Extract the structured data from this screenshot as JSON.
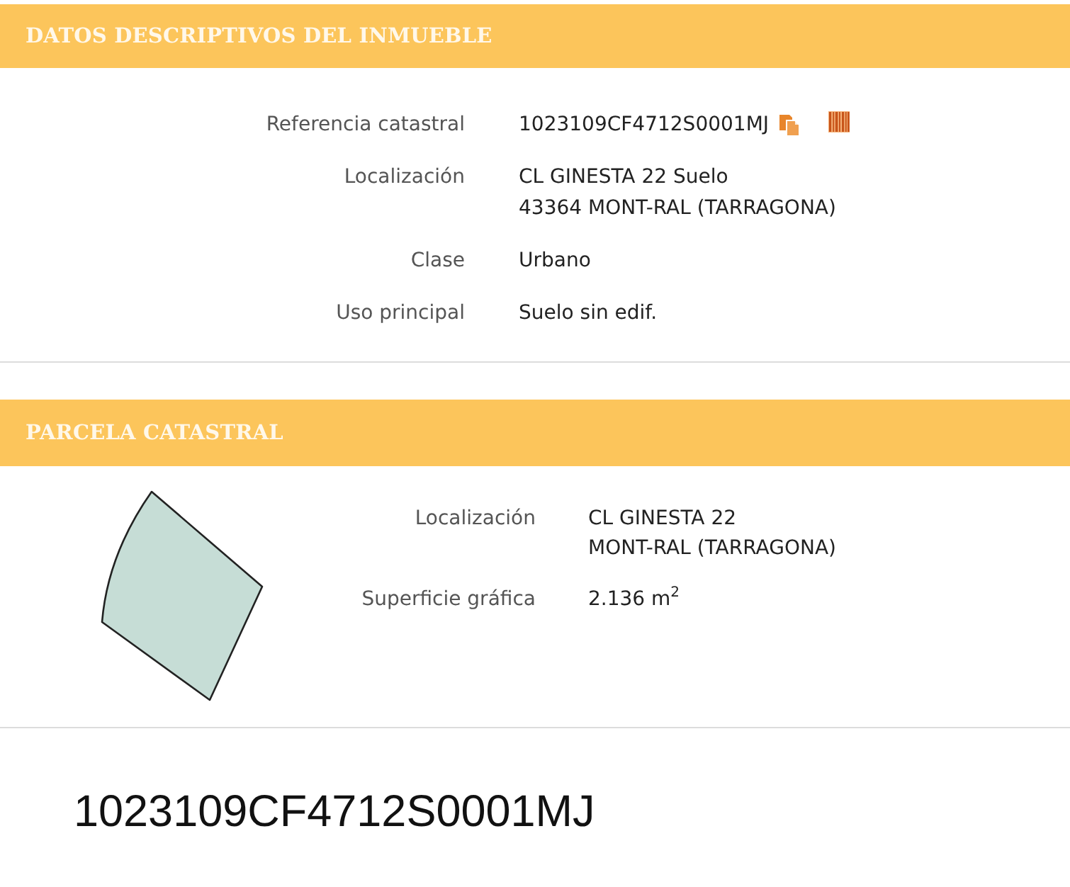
{
  "sections": [
    {
      "kind": "details",
      "title": "DATOS DESCRIPTIVOS DEL INMUEBLE",
      "fields": [
        {
          "kind": "reference",
          "label": "Referencia catastral",
          "lines": [
            "1023109CF4712S0001MJ"
          ]
        },
        {
          "kind": "text",
          "label": "Localización",
          "lines": [
            "CL GINESTA 22 Suelo",
            "43364 MONT-RAL (TARRAGONA)"
          ]
        },
        {
          "kind": "text",
          "label": "Clase",
          "lines": [
            "Urbano"
          ]
        },
        {
          "kind": "text",
          "label": "Uso principal",
          "lines": [
            "Suelo sin edif."
          ]
        }
      ]
    },
    {
      "kind": "parcel",
      "title": "PARCELA CATASTRAL",
      "fields": [
        {
          "kind": "text",
          "label": "Localización",
          "lines": [
            "CL GINESTA 22",
            "MONT-RAL (TARRAGONA)"
          ]
        },
        {
          "kind": "text",
          "label": "Superficie gráfica",
          "lines": [
            "2.136 m$^{2}$"
          ]
        }
      ]
    }
  ],
  "reference_code": "1023109CF4712S0001MJ"
}
